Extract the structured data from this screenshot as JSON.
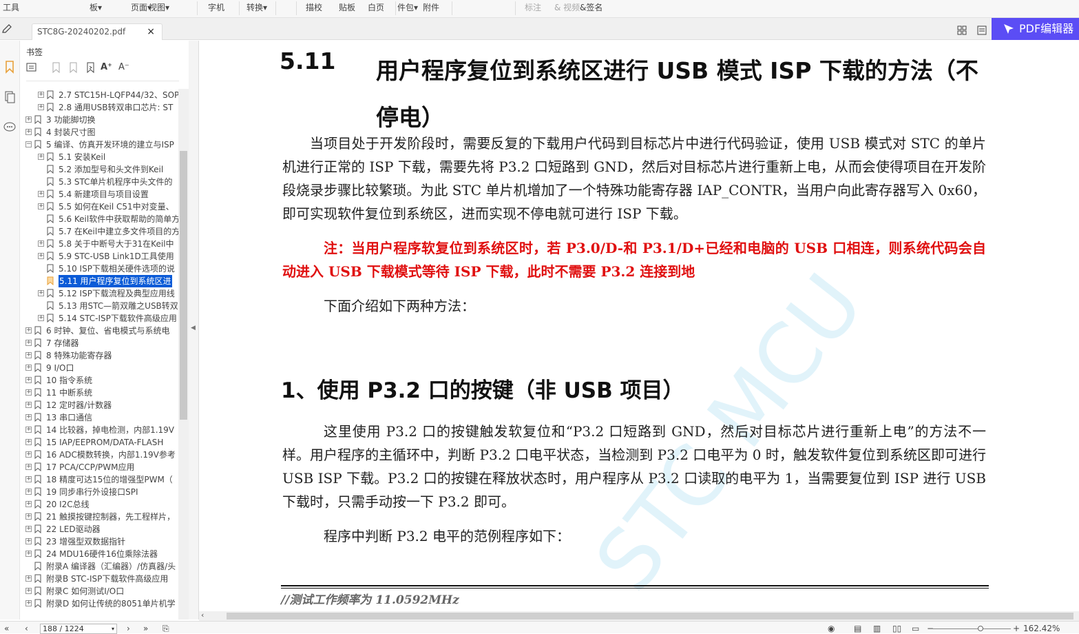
{
  "toolbar": {
    "items": [
      "工具",
      "板▾",
      "页面▾",
      "视图▾",
      "字机",
      "转换▾",
      "描校",
      "贴板",
      "白页",
      "件包▾",
      "附件",
      "标注",
      "& 视频",
      "&签名"
    ],
    "dim_from": 11
  },
  "tab": {
    "title": "STC8G-20240202.pdf",
    "close": "×"
  },
  "pdf_button": {
    "label": "PDF编辑器"
  },
  "panel": {
    "title": "书签"
  },
  "bookmarks": [
    {
      "level": 2,
      "exp": "+",
      "label": "2.7  STC15H-LQFP44/32、SOP"
    },
    {
      "level": 2,
      "exp": "+",
      "label": "2.8  通用USB转双串口芯片: ST"
    },
    {
      "level": 1,
      "exp": "+",
      "label": "3  功能脚切换"
    },
    {
      "level": 1,
      "exp": "+",
      "label": "4  封装尺寸图"
    },
    {
      "level": 1,
      "exp": "−",
      "label": "5  编译、仿真开发环境的建立与ISP"
    },
    {
      "level": 2,
      "exp": "+",
      "label": "5.1  安装Keil"
    },
    {
      "level": 2,
      "exp": "",
      "label": "5.2  添加型号和头文件到Keil"
    },
    {
      "level": 2,
      "exp": "",
      "label": "5.3  STC单片机程序中头文件的"
    },
    {
      "level": 2,
      "exp": "+",
      "label": "5.4  新建项目与项目设置"
    },
    {
      "level": 2,
      "exp": "+",
      "label": "5.5  如何在Keil C51中对变量、"
    },
    {
      "level": 2,
      "exp": "",
      "label": "5.6  Keil软件中获取帮助的简单方"
    },
    {
      "level": 2,
      "exp": "",
      "label": "5.7  在Keil中建立多文件项目的方"
    },
    {
      "level": 2,
      "exp": "+",
      "label": "5.8  关于中断号大于31在Keil中"
    },
    {
      "level": 2,
      "exp": "+",
      "label": "5.9  STC-USB Link1D工具使用"
    },
    {
      "level": 2,
      "exp": "",
      "label": "5.10  ISP下载相关硬件选项的说"
    },
    {
      "level": 2,
      "exp": "",
      "label": "5.11  用户程序复位到系统区进",
      "selected": true
    },
    {
      "level": 2,
      "exp": "+",
      "label": "5.12  ISP下载流程及典型应用线"
    },
    {
      "level": 2,
      "exp": "",
      "label": "5.13  用STC—箭双雕之USB转双"
    },
    {
      "level": 2,
      "exp": "+",
      "label": "5.14  STC-ISP下载软件高级应用"
    },
    {
      "level": 1,
      "exp": "+",
      "label": "6  时钟、复位、省电模式与系统电"
    },
    {
      "level": 1,
      "exp": "+",
      "label": "7  存储器"
    },
    {
      "level": 1,
      "exp": "+",
      "label": "8  特殊功能寄存器"
    },
    {
      "level": 1,
      "exp": "+",
      "label": "9  I/O口"
    },
    {
      "level": 1,
      "exp": "+",
      "label": "10  指令系统"
    },
    {
      "level": 1,
      "exp": "+",
      "label": "11  中断系统"
    },
    {
      "level": 1,
      "exp": "+",
      "label": "12  定时器/计数器"
    },
    {
      "level": 1,
      "exp": "+",
      "label": "13  串口通信"
    },
    {
      "level": 1,
      "exp": "+",
      "label": "14  比较器，掉电检测，内部1.19V"
    },
    {
      "level": 1,
      "exp": "+",
      "label": "15  IAP/EEPROM/DATA-FLASH"
    },
    {
      "level": 1,
      "exp": "+",
      "label": "16  ADC模数转换，内部1.19V参考"
    },
    {
      "level": 1,
      "exp": "+",
      "label": "17  PCA/CCP/PWM应用"
    },
    {
      "level": 1,
      "exp": "+",
      "label": "18  精度可达15位的增强型PWM（"
    },
    {
      "level": 1,
      "exp": "+",
      "label": "19  同步串行外设接口SPI"
    },
    {
      "level": 1,
      "exp": "+",
      "label": "20  I2C总线"
    },
    {
      "level": 1,
      "exp": "+",
      "label": "21  触摸按键控制器，先工程样片，"
    },
    {
      "level": 1,
      "exp": "+",
      "label": "22  LED驱动器"
    },
    {
      "level": 1,
      "exp": "+",
      "label": "23  增强型双数据指针"
    },
    {
      "level": 1,
      "exp": "+",
      "label": "24  MDU16硬件16位乘除法器"
    },
    {
      "level": 1,
      "exp": "",
      "label": "附录A  编译器（汇编器）/仿真器/头"
    },
    {
      "level": 1,
      "exp": "+",
      "label": "附录B  STC-ISP下载软件高级应用"
    },
    {
      "level": 1,
      "exp": "+",
      "label": "附录C  如何测试I/O口"
    },
    {
      "level": 1,
      "exp": "+",
      "label": "附录D  如何让传统的8051单片机学"
    }
  ],
  "doc": {
    "section_num": "5.11",
    "section_title": "用户程序复位到系统区进行 USB 模式 ISP 下载的方法（不停电）",
    "p1": "当项目处于开发阶段时，需要反复的下载用户代码到目标芯片中进行代码验证，使用 USB 模式对 STC 的单片机进行正常的 ISP 下载，需要先将 P3.2 口短路到 GND，然后对目标芯片进行重新上电，从而会使得项目在开发阶段烧录步骤比较繁琐。为此 STC 单片机增加了一个特殊功能寄存器 IAP_CONTR，当用户向此寄存器写入 0x60，即可实现软件复位到系统区，进而实现不停电就可进行 ISP 下载。",
    "note": "注：当用户程序软复位到系统区时，若 P3.0/D-和 P3.1/D+已经和电脑的 USB 口相连，则系统代码会自动进入 USB 下载模式等待 ISP 下载，此时不需要 P3.2 连接到地",
    "p2": "下面介绍如下两种方法：",
    "h1": "1、使用 P3.2 口的按键（非 USB 项目）",
    "p3": "这里使用 P3.2 口的按键触发软复位和“P3.2 口短路到 GND，然后对目标芯片进行重新上电”的方法不一样。用户程序的主循环中，判断 P3.2 口电平状态，当检测到 P3.2 口电平为 0 时，触发软件复位到系统区即可进行 USB ISP 下载。P3.2 口的按键在释放状态时，用户程序从 P3.2 口读取的电平为 1，当需要复位到 ISP 进行 USB 下载时，只需手动按一下 P3.2 即可。",
    "p4": "程序中判断 P3.2 电平的范例程序如下：",
    "code": "//测试工作频率为 11.0592MHz",
    "watermark": "STC MCU"
  },
  "status": {
    "page": "188 / 1224",
    "zoom": "162.42%"
  },
  "colors": {
    "accent": "#5b4df5",
    "selection": "#0b5bd7",
    "note": "#e01010",
    "bookmark_orange": "#e8a13a"
  }
}
